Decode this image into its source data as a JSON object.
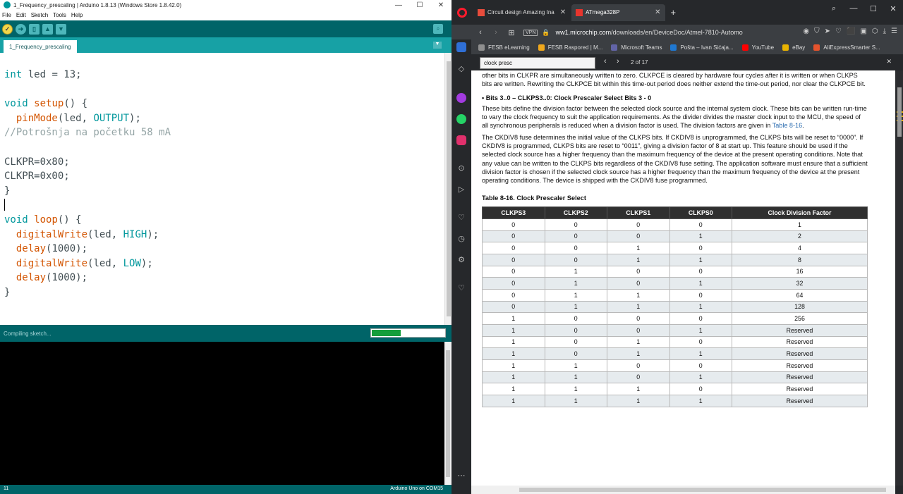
{
  "arduino": {
    "window_title": "1_Frequency_prescaling | Arduino 1.8.13 (Windows Store 1.8.42.0)",
    "menu": [
      "File",
      "Edit",
      "Sketch",
      "Tools",
      "Help"
    ],
    "tab_label": "1_Frequency_prescaling",
    "status_text": "Compiling sketch...",
    "progress_fraction": 0.4,
    "line_number": "11",
    "board": "Arduino Uno on COM15",
    "toolbar_icons": [
      "verify-icon",
      "upload-icon",
      "new-icon",
      "open-icon",
      "save-icon",
      "serial-monitor-icon"
    ]
  },
  "opera": {
    "tabs": [
      {
        "label": "Circuit design Amazing Ina",
        "icon": "tinkercad-icon"
      },
      {
        "label": "ATmega328P",
        "icon": "pdf-icon"
      }
    ],
    "url_host": "ww1.microchip.com",
    "url_path": "/downloads/en/DeviceDoc/Atmel-7810-Automo",
    "vpn_label": "VPN",
    "bookmarks": [
      {
        "label": "FESB eLearning",
        "color": "#8f8f8f"
      },
      {
        "label": "FESB Raspored | M...",
        "color": "#f0a81c"
      },
      {
        "label": "Microsoft Teams",
        "color": "#6264a7"
      },
      {
        "label": "Pošta – Ivan Sićaja...",
        "color": "#1f78d1"
      },
      {
        "label": "YouTube",
        "color": "#ff0000"
      },
      {
        "label": "eBay",
        "color": "#e9b300"
      },
      {
        "label": "AliExpressSmarter S...",
        "color": "#e5532d"
      }
    ],
    "find": {
      "query": "clock presc",
      "count": "2 of 17"
    },
    "pdf": {
      "para1": "other bits in CLKPR are simultaneously written to zero. CLKPCE is cleared by hardware four cycles after it is written or when CLKPS bits are written. Rewriting the CLKPCE bit within this time-out period does neither extend the time-out period, nor clear the CLKPCE bit.",
      "bullet": "•   Bits 3..0 – CLKPS3..0: Clock Prescaler Select Bits 3 - 0",
      "para2": "These bits define the division factor between the selected clock source and the internal system clock. These bits can be written run-time to vary the clock frequency to suit the application requirements. As the divider divides the master clock input to the MCU, the speed of all synchronous peripherals is reduced when a division factor is used. The division factors are given in",
      "para2_link": "Table 8-16",
      "para3": "The CKDIV8 fuse determines the initial value of the CLKPS bits. If CKDIV8 is unprogrammed, the CLKPS bits will be reset to “0000”. If CKDIV8 is programmed, CLKPS bits are reset to “0011”, giving a division factor of 8 at start up. This feature should be used if the selected clock source has a higher frequency than the maximum frequency of the device at the present operating conditions. Note that any value can be written to the CLKPS bits regardless of the CKDIV8 fuse setting. The application software must ensure that a sufficient division factor is chosen if the selected clock source has a higher frequency than the maximum frequency of the device at the present operating conditions. The device is shipped with the CKDIV8 fuse programmed.",
      "table_caption": "Table 8-16.   Clock Prescaler Select",
      "table_headers": [
        "CLKPS3",
        "CLKPS2",
        "CLKPS1",
        "CLKPS0",
        "Clock Division Factor"
      ],
      "table_rows": [
        [
          "0",
          "0",
          "0",
          "0",
          "1"
        ],
        [
          "0",
          "0",
          "0",
          "1",
          "2"
        ],
        [
          "0",
          "0",
          "1",
          "0",
          "4"
        ],
        [
          "0",
          "0",
          "1",
          "1",
          "8"
        ],
        [
          "0",
          "1",
          "0",
          "0",
          "16"
        ],
        [
          "0",
          "1",
          "0",
          "1",
          "32"
        ],
        [
          "0",
          "1",
          "1",
          "0",
          "64"
        ],
        [
          "0",
          "1",
          "1",
          "1",
          "128"
        ],
        [
          "1",
          "0",
          "0",
          "0",
          "256"
        ],
        [
          "1",
          "0",
          "0",
          "1",
          "Reserved"
        ],
        [
          "1",
          "0",
          "1",
          "0",
          "Reserved"
        ],
        [
          "1",
          "0",
          "1",
          "1",
          "Reserved"
        ],
        [
          "1",
          "1",
          "0",
          "0",
          "Reserved"
        ],
        [
          "1",
          "1",
          "0",
          "1",
          "Reserved"
        ],
        [
          "1",
          "1",
          "1",
          "0",
          "Reserved"
        ],
        [
          "1",
          "1",
          "1",
          "1",
          "Reserved"
        ]
      ]
    }
  },
  "code": {
    "l1_kw": "int",
    "l1_rest": " led = 13;",
    "l3_kw": "void",
    "l3_fn": "setup",
    "l3_rest": "() {",
    "l4_fn": "pinMode",
    "l4_a": "(led, ",
    "l4_const": "OUTPUT",
    "l4_b": ");",
    "l5_comment": "//Potrošnja na početku 58 mA",
    "l7": "CLKPR=0x80;",
    "l8": "CLKPR=0x00;",
    "l9": "}",
    "l11_kw": "void",
    "l11_fn": "loop",
    "l11_rest": "() {",
    "l12_fn": "digitalWrite",
    "l12_a": "(led, ",
    "l12_const": "HIGH",
    "l12_b": ");",
    "l13_fn": "delay",
    "l13_rest": "(1000);",
    "l14_fn": "digitalWrite",
    "l14_a": "(led, ",
    "l14_const": "LOW",
    "l14_b": ");",
    "l15_fn": "delay",
    "l15_rest": "(1000);",
    "l16": "}"
  }
}
